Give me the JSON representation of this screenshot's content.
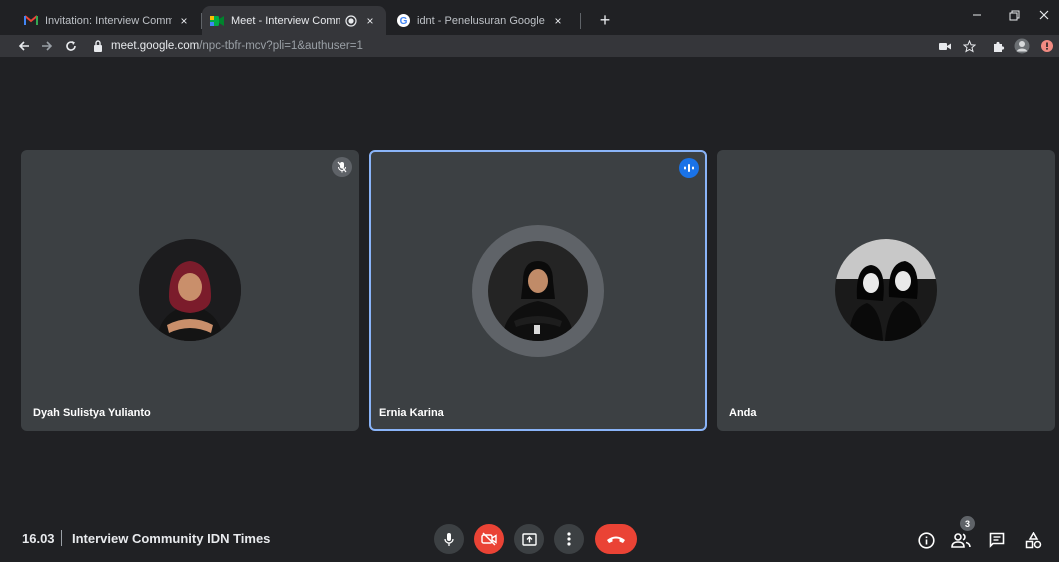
{
  "browser": {
    "tabs": [
      {
        "title": "Invitation: Interview Community I",
        "icon": "gmail-icon",
        "active": false
      },
      {
        "title": "Meet - Interview Community",
        "icon": "google-meet-icon",
        "active": true
      },
      {
        "title": "idnt - Penelusuran Google",
        "icon": "google-icon",
        "active": false
      }
    ],
    "close_glyph": "×",
    "new_tab_glyph": "+",
    "url_host": "meet.google.com",
    "url_path": "/npc-tbfr-mcv?pli=1&authuser=1"
  },
  "participants": [
    {
      "name": "Dyah Sulistya Yulianto",
      "muted": true,
      "speaking": false
    },
    {
      "name": "Ernia Karina",
      "muted": false,
      "speaking": true
    },
    {
      "name": "Anda",
      "muted": false,
      "speaking": false
    }
  ],
  "meeting": {
    "time": "16.03",
    "title": "Interview Community IDN Times",
    "participant_count": "3"
  },
  "colors": {
    "background": "#202124",
    "tile": "#3c4043",
    "accent": "#8ab4f8",
    "speaking_badge": "#1a73e8",
    "end_call": "#ea4335"
  }
}
